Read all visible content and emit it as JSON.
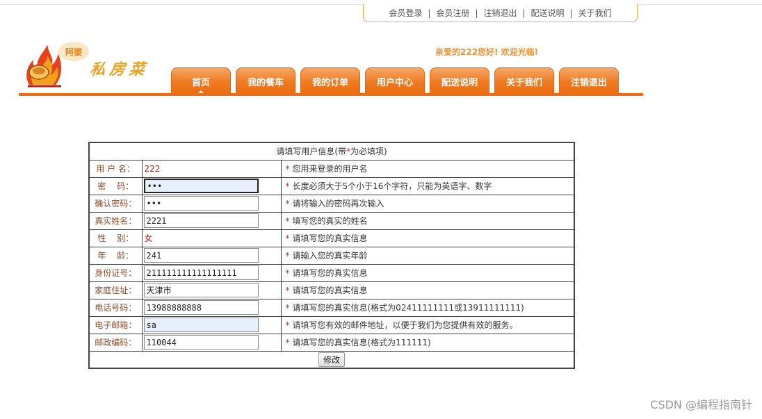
{
  "top_links": [
    "会员登录",
    "会员注册",
    "注销退出",
    "配送说明",
    "关于我们"
  ],
  "logo": {
    "badge": "阿婆",
    "brand": "私房菜"
  },
  "welcome": "亲爱的222您好! 欢迎光临!",
  "nav_tabs": [
    "首页",
    "我的餐车",
    "我的订单",
    "用户中心",
    "配送说明",
    "关于我们",
    "注销退出"
  ],
  "form": {
    "title_pre": "请填写用户信息(带",
    "title_star": "*",
    "title_post": "为必填项)",
    "rows": [
      {
        "label": "用 户 名：",
        "value": "222",
        "tip": "您用来登录的用户名"
      },
      {
        "label": "密　 码：",
        "value": "•••",
        "tip": "长度必须大于5个小于16个字符，只能为英语字、数字"
      },
      {
        "label": "确认密码：",
        "value": "•••",
        "tip": "请将输入的密码再次输入"
      },
      {
        "label": "真实姓名：",
        "value": "2221",
        "tip": "填写您的真实的姓名"
      },
      {
        "label": "性　 别：",
        "value": "女",
        "tip": "请填写您的真实信息"
      },
      {
        "label": "年　 龄：",
        "value": "241",
        "tip": "请输入您的真实年龄"
      },
      {
        "label": "身份证号：",
        "value": "211111111111111111",
        "tip": "请填写您的真实信息"
      },
      {
        "label": "家庭住址：",
        "value": "天津市",
        "tip": "请填写您的真实信息"
      },
      {
        "label": "电话号码：",
        "value": "13988888888",
        "tip": "请填写您的真实信息(格式为02411111111或13911111111)"
      },
      {
        "label": "电子邮箱：",
        "value": "sa",
        "tip": "请填写您有效的邮件地址，以便于我们为您提供有效的服务。"
      },
      {
        "label": "邮政编码：",
        "value": "110044",
        "tip": "请填写您的真实信息(格式为111111)"
      }
    ],
    "submit_label": "修改",
    "required_mark": "*"
  },
  "watermark": "CSDN @编程指南针",
  "colors": {
    "accent": "#ec6d12",
    "label_text": "#8a4b2a",
    "required": "#e02020",
    "welcome": "#f09030"
  }
}
